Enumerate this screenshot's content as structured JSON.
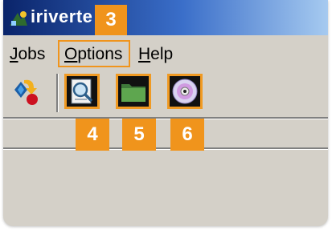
{
  "window": {
    "title": "iriverte"
  },
  "menu": {
    "items": [
      {
        "accel": "J",
        "rest": "obs"
      },
      {
        "accel": "O",
        "rest": "ptions"
      },
      {
        "accel": "H",
        "rest": "elp"
      }
    ]
  },
  "toolbar": {
    "buttons": [
      {
        "icon": "transfer-icon"
      },
      {
        "icon": "search-document-icon"
      },
      {
        "icon": "folder-icon"
      },
      {
        "icon": "cd-disc-icon"
      }
    ]
  },
  "callouts": [
    "3",
    "4",
    "5",
    "6"
  ],
  "colors": {
    "callout": "#f0941c",
    "titlebar": "#0a246a"
  }
}
